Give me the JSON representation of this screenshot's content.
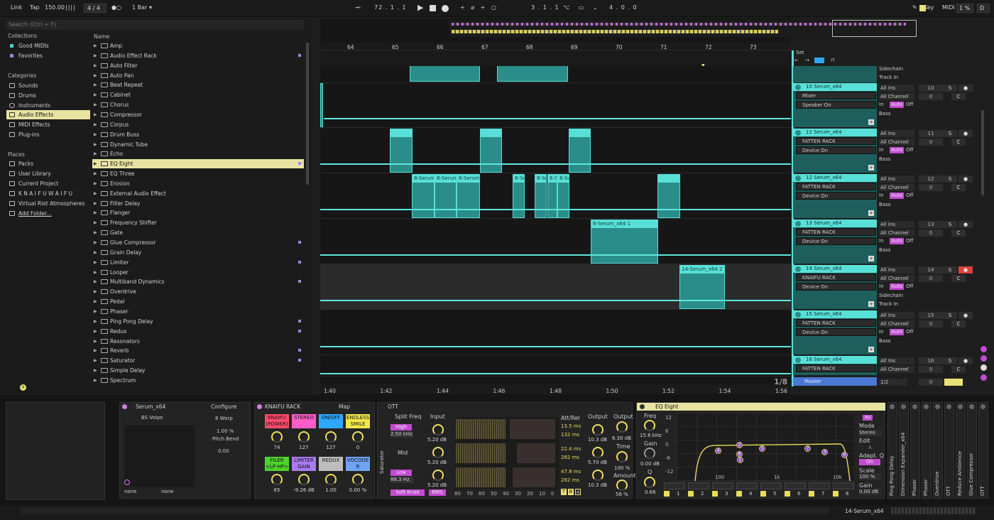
{
  "topbar": {
    "link": "Link",
    "tap": "Tap",
    "tempo": "150.00",
    "signature": "4 / 4",
    "quant": "1 Bar",
    "position": "72 .  1 .  1",
    "loop_start": "3 .  1 .  1",
    "loop_len": "4 .  0 .  0",
    "key": "Key",
    "midi": "MIDI",
    "cpu": "1 %",
    "d": "D"
  },
  "browser": {
    "search_placeholder": "Search (Ctrl + F)",
    "collections_head": "Collections",
    "collections": [
      "Good MIDIs",
      "Favorites"
    ],
    "categories_head": "Categories",
    "categories": [
      "Sounds",
      "Drums",
      "Instruments",
      "Audio Effects",
      "MIDI Effects",
      "Plug-ins"
    ],
    "places_head": "Places",
    "places": [
      "Packs",
      "User Library",
      "Current Project",
      "K N A I F U   W A I F U",
      "Virtual Riot Atmospheres",
      "Add Folder..."
    ],
    "name_head": "Name",
    "items": [
      "Amp",
      "Audio Effect Rack",
      "Auto Filter",
      "Auto Pan",
      "Beat Repeat",
      "Cabinet",
      "Chorus",
      "Compressor",
      "Corpus",
      "Drum Buss",
      "Dynamic Tube",
      "Echo",
      "EQ Eight",
      "EQ Three",
      "Erosion",
      "External Audio Effect",
      "Filter Delay",
      "Flanger",
      "Frequency Shifter",
      "Gate",
      "Glue Compressor",
      "Grain Delay",
      "Limiter",
      "Looper",
      "Multiband Dynamics",
      "Overdrive",
      "Pedal",
      "Phaser",
      "Ping Pong Delay",
      "Redux",
      "Resonators",
      "Reverb",
      "Saturator",
      "Simple Delay",
      "Spectrum"
    ]
  },
  "arrangement": {
    "bars": [
      "64",
      "65",
      "66",
      "67",
      "68",
      "69",
      "70",
      "71",
      "72",
      "73"
    ],
    "times": [
      "1:40",
      "1:42",
      "1:44",
      "1:46",
      "1:48",
      "1:50",
      "1:52",
      "1:54",
      "1:56"
    ],
    "set_label": "Set",
    "grid": "1/8",
    "clips": {
      "c12a": "8-Serum",
      "c12b": "8-Serum",
      "c12c": "8-Serum",
      "c12d": "8-Se",
      "c12e": "8-Se",
      "c12f": "8-Se",
      "c12g": "8-Se",
      "c13": "8-Serum_x64 1",
      "c14": "14-Serum_x64 2"
    }
  },
  "tracks": [
    {
      "name": "10 Serum_x64",
      "dd1": "Mixer",
      "dd2": "Speaker On",
      "input": "All Ins",
      "channel": "All Channel",
      "route": "Bass",
      "num": "10"
    },
    {
      "name": "11 Serum_x64",
      "dd1": "FATTEN RACK",
      "dd2": "Device On",
      "input": "All Ins",
      "channel": "All Channel",
      "route": "Bass",
      "num": "11"
    },
    {
      "name": "12 Serum_x64",
      "dd1": "FATTEN RACK",
      "dd2": "Device On",
      "input": "All Ins",
      "channel": "All Channel",
      "route": "Bass",
      "num": "12"
    },
    {
      "name": "13 Serum_x64",
      "dd1": "FATTEN RACK",
      "dd2": "Device On",
      "input": "All Ins",
      "channel": "All Channel",
      "route": "Bass",
      "num": "13"
    },
    {
      "name": "14 Serum_x64",
      "dd1": "KNAIFU RACK",
      "dd2": "Device On",
      "input": "All Ins",
      "channel": "All Channel",
      "route": "Sidechain",
      "num": "14"
    },
    {
      "name": "15 Serum_x64",
      "dd1": "FATTEN RACK",
      "dd2": "Device On",
      "input": "All Ins",
      "channel": "All Channel",
      "route": "Bass",
      "num": "15"
    },
    {
      "name": "16 Serum_x64",
      "dd1": "FATTEN RACK",
      "dd2": "",
      "input": "All Ins",
      "channel": "All Channel",
      "route": "",
      "num": "16"
    }
  ],
  "mixer": {
    "sidechain": "Sidechain",
    "track_in": "Track In",
    "in": "In",
    "auto": "Auto",
    "off": "Off",
    "zero": "0",
    "c": "C",
    "s": "S",
    "master": "Master",
    "master_io": "1/2",
    "master_zero": "0"
  },
  "devices": {
    "serum": {
      "title": "Serum_x64",
      "configure": "Configure",
      "preset": "BS Volpe",
      "warp": "8 Warp",
      "pct": "1.00 %",
      "pitch_bend": "Pitch Bend",
      "pb_val": "0.00",
      "none1": "none",
      "none2": "none"
    },
    "knaifu": {
      "title": "KNAIFU RACK",
      "map": "Map",
      "macros": [
        {
          "label": "KNAIFU (POWER)",
          "value": "74",
          "color": "#ff4a6a"
        },
        {
          "label": "STEREO",
          "value": "127",
          "color": "#ff5ec8"
        },
        {
          "label": "ON/OFF",
          "value": "127",
          "color": "#2ea7ff"
        },
        {
          "label": "ENDLESS SMILE",
          "value": "0",
          "color": "#f2e64a"
        },
        {
          "label": "FILER <LP-HP>",
          "value": "65",
          "color": "#4ed12a"
        },
        {
          "label": "LIMITER GAIN",
          "value": "-9.26 dB",
          "color": "#a97bf0"
        },
        {
          "label": "REDUX",
          "value": "1.00",
          "color": "#bdbdbd"
        },
        {
          "label": "VOCODE R",
          "value": "0.00 %",
          "color": "#6ea3f6"
        }
      ]
    },
    "ott": {
      "title": "OTT",
      "saturator": "Saturator",
      "split_freq": "Split Freq",
      "input": "Input",
      "high": "High",
      "high_freq": "2.50 kHz",
      "mid": "Mid",
      "low": "Low",
      "low_freq": "88.3 Hz",
      "in_high": "5.20 dB",
      "in_mid": "5.20 dB",
      "in_low": "5.20 dB",
      "att_rel": "Att/Rel",
      "ar": [
        "13.5 ms",
        "132 ms",
        "22.4 ms",
        "282 ms",
        "47.8 ms",
        "282 ms"
      ],
      "output": "Output",
      "out_high": "10.3 dB",
      "out_mid": "5.70 dB",
      "out_low": "10.3 dB",
      "output2": "Output",
      "out2": "6.30 dB",
      "time": "Time",
      "time_val": "100 %",
      "amount": "Amount",
      "amount_val": "58 %",
      "soft_knee": "Soft Knee",
      "rms": "RMS",
      "scale": [
        "80",
        "70",
        "60",
        "50",
        "40",
        "30",
        "20",
        "10",
        "0"
      ],
      "t": "T",
      "b": "B",
      "a": "A"
    },
    "eq": {
      "title": "EQ Eight",
      "freq": "Freq",
      "freq_val": "15.6 kHz",
      "gain": "Gain",
      "gain_val": "0.00 dB",
      "q": "Q",
      "q_val": "0.66",
      "db_scale": [
        "12",
        "6",
        "0",
        "-6",
        "-12"
      ],
      "hz_scale": [
        "100",
        "1k",
        "10k"
      ],
      "mode": "Mode",
      "mode_val": "Stereo",
      "edit": "Edit",
      "edit_val": "A",
      "adapt_q": "Adapt. Q",
      "on": "On",
      "scale": "Scale",
      "scale_val": "100 %",
      "gain2": "Gain",
      "gain2_val": "0.00 dB",
      "bands": [
        "1",
        "2",
        "3",
        "4",
        "5",
        "6",
        "7",
        "8"
      ],
      "nodes": [
        "1",
        "2",
        "3",
        "4",
        "5",
        "6",
        "7",
        "8"
      ]
    },
    "chain": [
      "Ping Pong Delay",
      "Dimension Expander_x64",
      "Phaser",
      "Phaser",
      "Overdrive",
      "OTT",
      "Reduce Ambience",
      "Glue Compressor",
      "OTT"
    ]
  },
  "status": {
    "track": "14-Serum_x64"
  }
}
